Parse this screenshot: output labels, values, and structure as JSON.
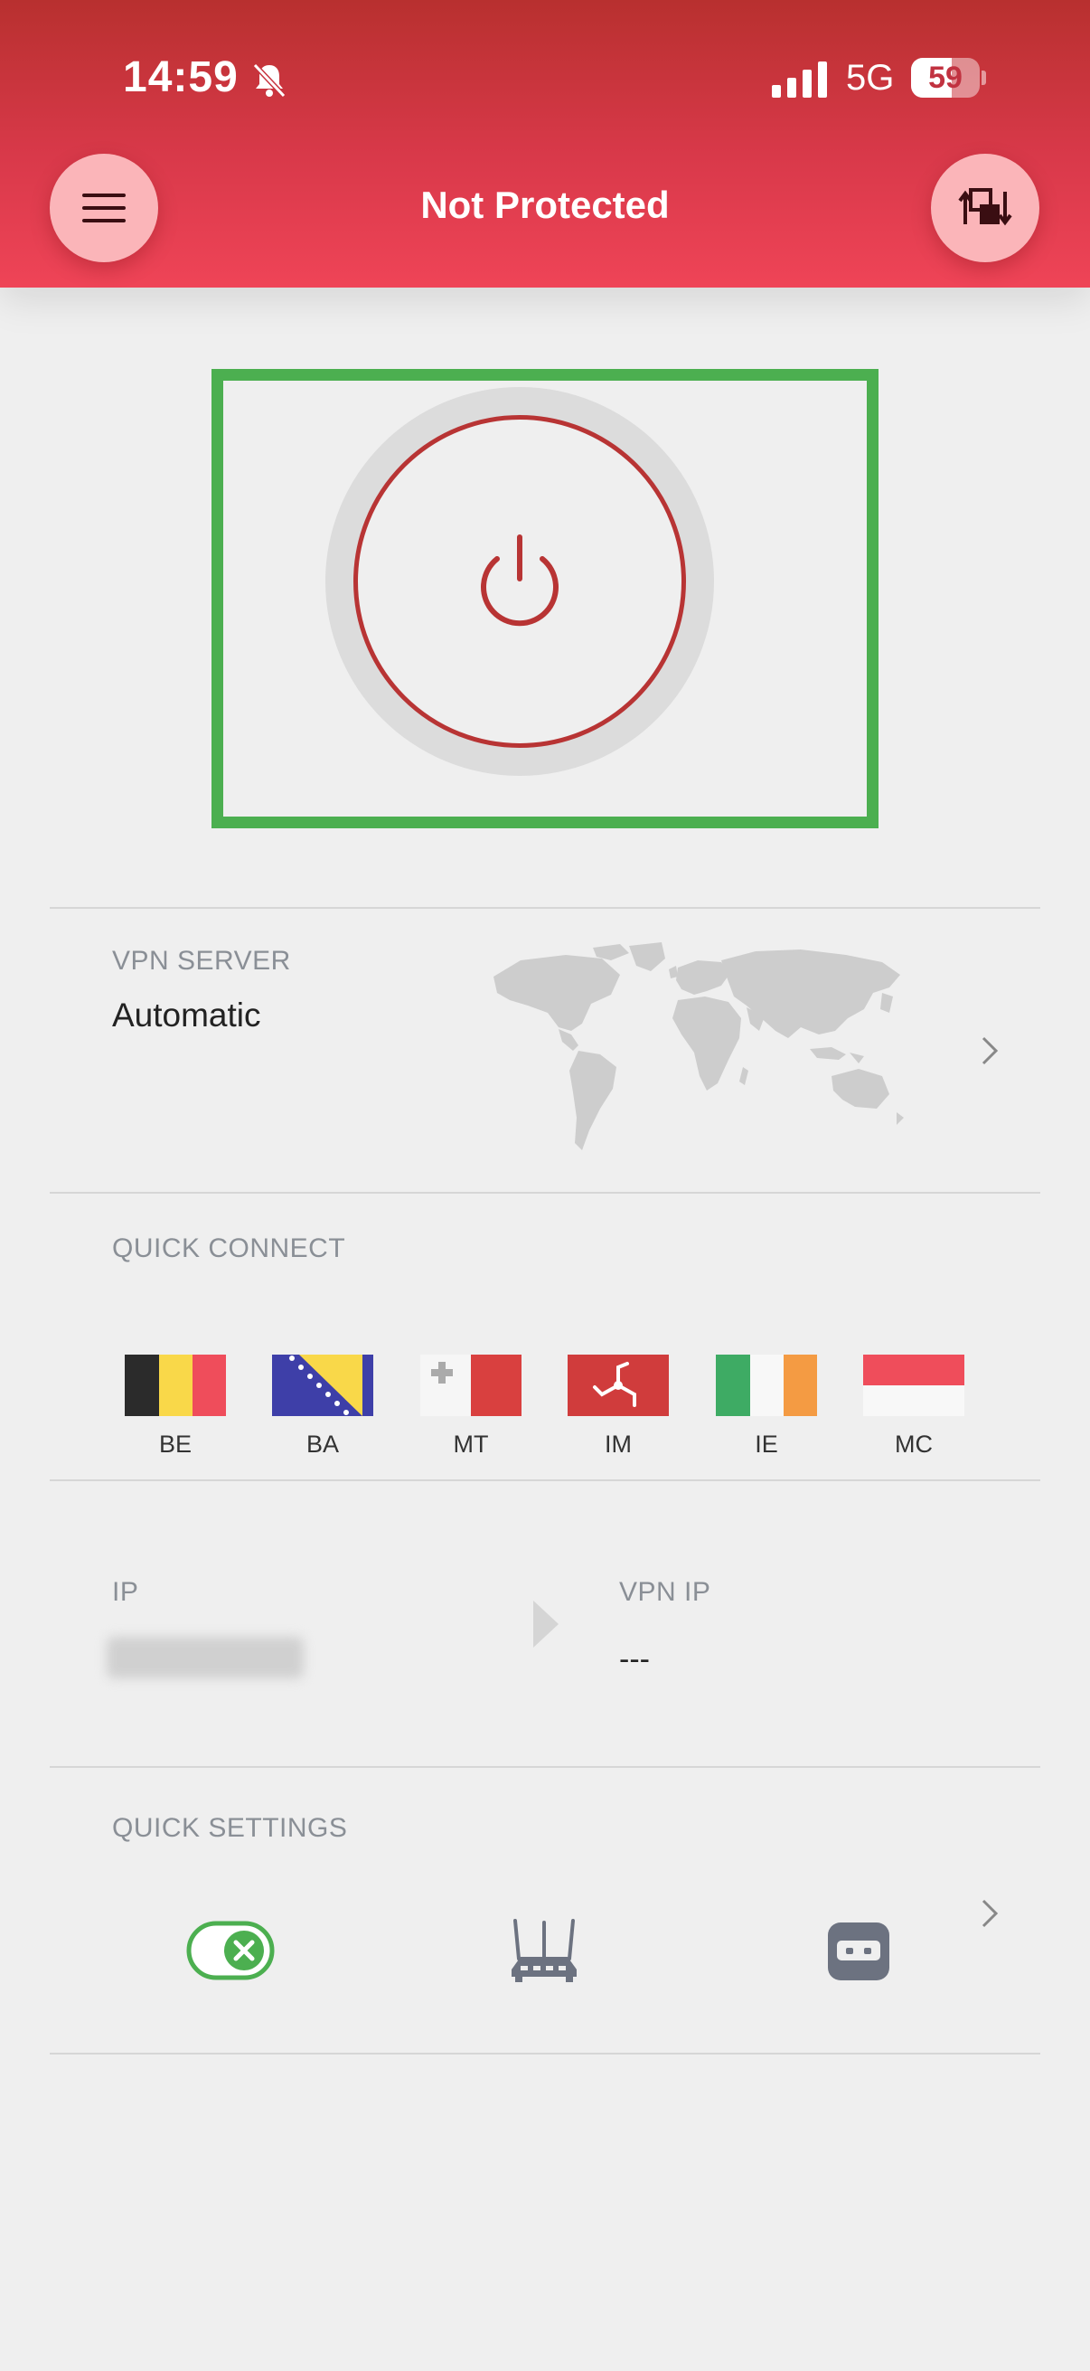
{
  "status_bar": {
    "time": "14:59",
    "network": "5G",
    "battery_level": "59",
    "battery_fraction": 0.59
  },
  "header": {
    "title": "Not Protected",
    "menu_icon": "hamburger-menu-icon",
    "switch_icon": "server-switch-icon"
  },
  "power": {
    "icon": "power-icon",
    "accent_color": "#b83434",
    "highlight_color": "#4caf50"
  },
  "vpn_server": {
    "label": "VPN SERVER",
    "value": "Automatic"
  },
  "quick_connect": {
    "label": "QUICK CONNECT",
    "flags": [
      {
        "code": "BE"
      },
      {
        "code": "BA"
      },
      {
        "code": "MT"
      },
      {
        "code": "IM"
      },
      {
        "code": "IE"
      },
      {
        "code": "MC"
      }
    ]
  },
  "ip_info": {
    "ip_label": "IP",
    "vpn_ip_label": "VPN IP",
    "vpn_ip_value": "---"
  },
  "quick_settings": {
    "label": "QUICK SETTINGS",
    "items": [
      {
        "icon": "kill-switch-toggle-icon"
      },
      {
        "icon": "router-icon"
      },
      {
        "icon": "ad-blocker-mask-icon"
      }
    ]
  },
  "colors": {
    "header_top": "#b8302f",
    "header_bottom": "#ef4457",
    "button_bg": "#fbb5b9",
    "toggle_green": "#4caf50"
  }
}
